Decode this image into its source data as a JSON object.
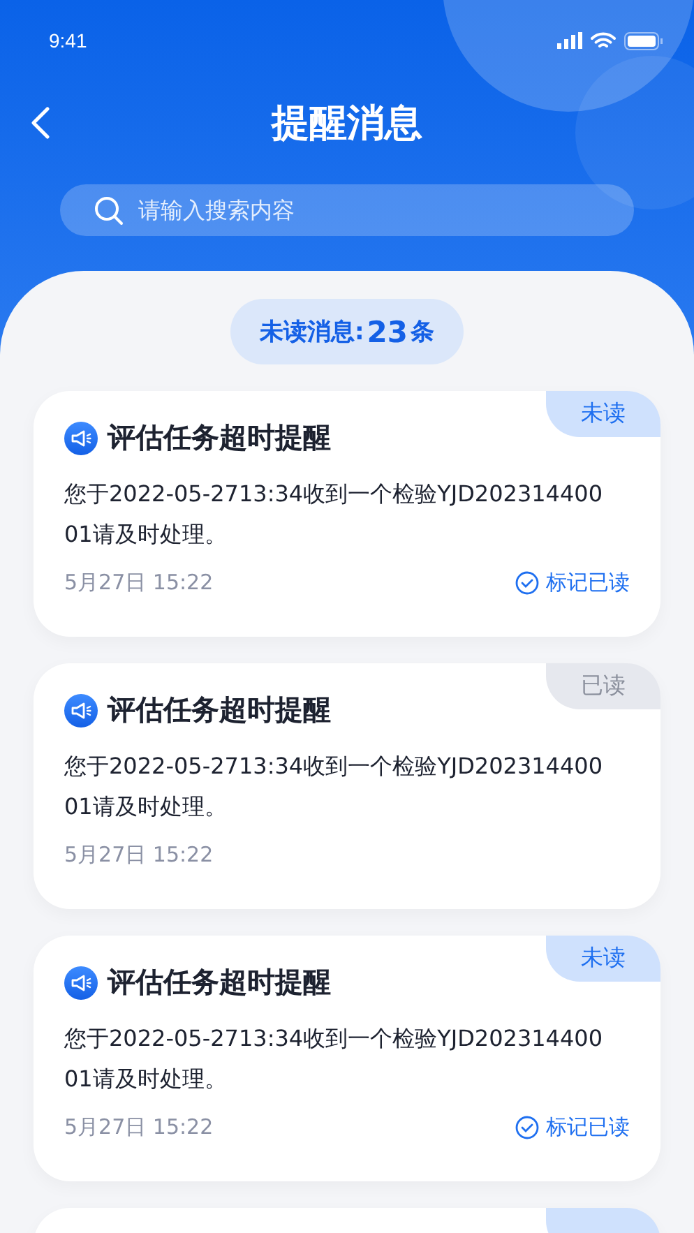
{
  "status_bar": {
    "time": "9:41"
  },
  "header": {
    "title": "提醒消息"
  },
  "search": {
    "placeholder": "请输入搜索内容"
  },
  "unread_summary": {
    "label": "未读消息:",
    "count": "23",
    "unit": "条"
  },
  "messages": [
    {
      "title": "评估任务超时提醒",
      "body": "您于2022-05-2713:34收到一个检验YJD20231440001请及时处理。",
      "time": "5月27日 15:22",
      "read": false,
      "status": "未读",
      "action": "标记已读"
    },
    {
      "title": "评估任务超时提醒",
      "body": "您于2022-05-2713:34收到一个检验YJD20231440001请及时处理。",
      "time": "5月27日 15:22",
      "read": true,
      "status": "已读"
    },
    {
      "title": "评估任务超时提醒",
      "body": "您于2022-05-2713:34收到一个检验YJD20231440001请及时处理。",
      "time": "5月27日 15:22",
      "read": false,
      "status": "未读",
      "action": "标记已读"
    },
    {
      "read": false
    }
  ]
}
